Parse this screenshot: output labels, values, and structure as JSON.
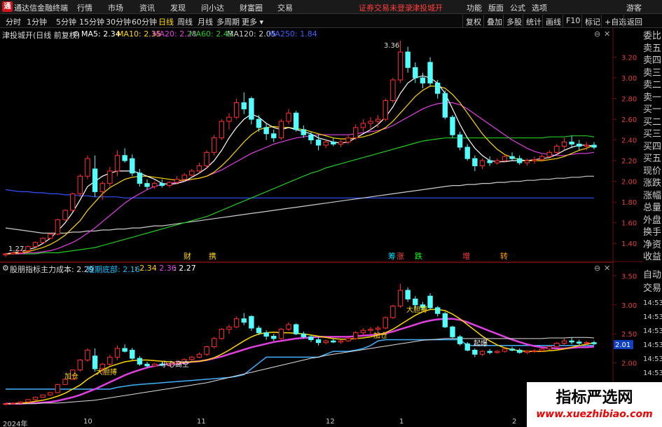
{
  "menubar": {
    "logo": "通",
    "app_name": "通达信金融终端",
    "items": [
      "行情",
      "市场",
      "资讯",
      "发现",
      "问小达",
      "财富圈",
      "交易"
    ],
    "notice": "证券交易未登录",
    "stock": "津投城开",
    "right_items": [
      "功能",
      "版面",
      "公式",
      "选项"
    ],
    "guest": "游客"
  },
  "toolbar": {
    "periods": [
      "分时",
      "1分钟",
      "5分钟",
      "15分钟",
      "30分钟",
      "60分钟",
      "日线",
      "周线",
      "月线",
      "多周期",
      "更多"
    ],
    "active_period": "日线",
    "buttons": [
      "复权",
      "叠加",
      "多股",
      "统计",
      "画线",
      "F10",
      "标记",
      "+自选",
      "返回"
    ]
  },
  "main_chart": {
    "title": "津投城开(日线 前复权)",
    "ma": [
      {
        "label": "MA5: 2.34",
        "color": "#ffffff"
      },
      {
        "label": "MA10: 2.35",
        "color": "#ffd700"
      },
      {
        "label": "MA20: 2.28",
        "color": "#e040e0"
      },
      {
        "label": "MA60: 2.43",
        "color": "#22cc22"
      },
      {
        "label": "MA120: 2.05",
        "color": "#cccccc"
      },
      {
        "label": "MA250: 1.84",
        "color": "#4060ff"
      }
    ],
    "y_ticks": [
      "3.20",
      "3.00",
      "2.80",
      "2.60",
      "2.40",
      "2.20",
      "2.00",
      "1.80",
      "1.60",
      "1.40"
    ],
    "high_label": "3.36",
    "low_label": "1.27",
    "event_marks": [
      {
        "text": "财",
        "color": "#ffd700"
      },
      {
        "text": "携",
        "color": "#ffd700"
      },
      {
        "text": "筹",
        "color": "#00e0ff"
      },
      {
        "text": "涨",
        "color": "#ff4040"
      },
      {
        "text": "跌",
        "color": "#00ff00"
      },
      {
        "text": "增",
        "color": "#ff4040"
      },
      {
        "text": "转",
        "color": "#ffa000"
      }
    ]
  },
  "sub_chart": {
    "title": "股朋指标",
    "main_cost_label": "主力成本: 2.29",
    "short_bottom_label": "短期底部: 2.16",
    "v2": ": 2.34",
    "v3": ": 2.36",
    "v4": ": 2.27",
    "y_ticks": [
      "3.50",
      "3.00",
      "2.50",
      "2.00"
    ],
    "current_value": "2.01",
    "signals": [
      "加仓",
      "大胆搏",
      "小心高空",
      "加仓",
      "大胆搏",
      "起爆"
    ]
  },
  "right_panel": {
    "items": [
      "委比",
      "卖五",
      "卖四",
      "卖三",
      "卖二",
      "卖一",
      "买一",
      "买二",
      "买三",
      "买四",
      "买五",
      "现价",
      "涨跌",
      "涨幅",
      "总量",
      "外盘",
      "换手",
      "净资",
      "收益"
    ],
    "lower": [
      "自动",
      "交易"
    ],
    "times": [
      "14:53",
      "14:53",
      "14:53",
      "14:53",
      "14:53",
      "14:53",
      "14:53"
    ]
  },
  "x_axis": {
    "labels": [
      "2024年",
      "10",
      "11",
      "12",
      "1",
      "2"
    ]
  },
  "watermark": {
    "title": "指标严选网",
    "url": "www.xuezhibiao.com"
  },
  "chart_data": {
    "type": "candlestick",
    "y_range": [
      1.3,
      3.4
    ],
    "ohlc": [
      [
        1.29,
        1.31,
        1.27,
        1.3
      ],
      [
        1.3,
        1.32,
        1.29,
        1.31
      ],
      [
        1.31,
        1.34,
        1.3,
        1.33
      ],
      [
        1.33,
        1.38,
        1.32,
        1.37
      ],
      [
        1.37,
        1.42,
        1.35,
        1.41
      ],
      [
        1.41,
        1.46,
        1.4,
        1.45
      ],
      [
        1.45,
        1.5,
        1.44,
        1.49
      ],
      [
        1.49,
        1.64,
        1.48,
        1.63
      ],
      [
        1.63,
        1.73,
        1.62,
        1.72
      ],
      [
        1.72,
        1.89,
        1.71,
        1.88
      ],
      [
        1.88,
        2.07,
        1.85,
        2.05
      ],
      [
        2.05,
        2.25,
        2.02,
        2.22
      ],
      [
        2.12,
        2.25,
        1.85,
        1.9
      ],
      [
        1.9,
        2.0,
        1.82,
        1.98
      ],
      [
        1.98,
        2.14,
        1.95,
        2.1
      ],
      [
        2.1,
        2.3,
        2.05,
        2.25
      ],
      [
        2.25,
        2.32,
        2.18,
        2.2
      ],
      [
        2.22,
        2.26,
        2.05,
        2.08
      ],
      [
        2.08,
        2.12,
        1.95,
        1.98
      ],
      [
        1.98,
        2.02,
        1.92,
        1.95
      ],
      [
        1.95,
        2.0,
        1.93,
        1.98
      ],
      [
        1.98,
        2.02,
        1.94,
        1.96
      ],
      [
        1.96,
        2.0,
        1.94,
        1.99
      ],
      [
        1.99,
        2.05,
        1.97,
        2.02
      ],
      [
        2.02,
        2.08,
        2.0,
        2.06
      ],
      [
        2.06,
        2.12,
        2.04,
        2.1
      ],
      [
        2.1,
        2.18,
        2.08,
        2.15
      ],
      [
        2.15,
        2.3,
        2.12,
        2.28
      ],
      [
        2.28,
        2.45,
        2.25,
        2.42
      ],
      [
        2.42,
        2.6,
        2.4,
        2.58
      ],
      [
        2.58,
        2.66,
        2.5,
        2.62
      ],
      [
        2.62,
        2.8,
        2.6,
        2.76
      ],
      [
        2.76,
        2.86,
        2.65,
        2.7
      ],
      [
        2.8,
        2.82,
        2.55,
        2.6
      ],
      [
        2.6,
        2.64,
        2.48,
        2.52
      ],
      [
        2.52,
        2.56,
        2.4,
        2.46
      ],
      [
        2.46,
        2.5,
        2.38,
        2.42
      ],
      [
        2.42,
        2.6,
        2.4,
        2.58
      ],
      [
        2.58,
        2.7,
        2.55,
        2.66
      ],
      [
        2.66,
        2.68,
        2.48,
        2.5
      ],
      [
        2.5,
        2.54,
        2.42,
        2.45
      ],
      [
        2.45,
        2.48,
        2.36,
        2.4
      ],
      [
        2.4,
        2.45,
        2.3,
        2.35
      ],
      [
        2.35,
        2.4,
        2.32,
        2.38
      ],
      [
        2.38,
        2.42,
        2.34,
        2.36
      ],
      [
        2.36,
        2.4,
        2.33,
        2.38
      ],
      [
        2.38,
        2.45,
        2.36,
        2.42
      ],
      [
        2.42,
        2.55,
        2.4,
        2.52
      ],
      [
        2.52,
        2.6,
        2.48,
        2.56
      ],
      [
        2.56,
        2.62,
        2.5,
        2.58
      ],
      [
        2.58,
        2.64,
        2.52,
        2.6
      ],
      [
        2.6,
        2.8,
        2.58,
        2.78
      ],
      [
        2.78,
        3.0,
        2.76,
        2.98
      ],
      [
        2.98,
        3.36,
        2.95,
        3.25
      ],
      [
        3.25,
        3.3,
        3.05,
        3.1
      ],
      [
        3.1,
        3.15,
        2.95,
        3.0
      ],
      [
        3.0,
        3.05,
        2.9,
        2.95
      ],
      [
        3.15,
        3.2,
        2.92,
        2.95
      ],
      [
        2.95,
        2.98,
        2.8,
        2.85
      ],
      [
        2.85,
        2.88,
        2.6,
        2.62
      ],
      [
        2.62,
        2.64,
        2.42,
        2.45
      ],
      [
        2.45,
        2.48,
        2.3,
        2.33
      ],
      [
        2.33,
        2.36,
        2.2,
        2.22
      ],
      [
        2.22,
        2.25,
        2.1,
        2.15
      ],
      [
        2.15,
        2.22,
        2.12,
        2.2
      ],
      [
        2.2,
        2.24,
        2.15,
        2.18
      ],
      [
        2.18,
        2.22,
        2.16,
        2.2
      ],
      [
        2.2,
        2.26,
        2.18,
        2.24
      ],
      [
        2.24,
        2.28,
        2.2,
        2.22
      ],
      [
        2.22,
        2.25,
        2.16,
        2.18
      ],
      [
        2.18,
        2.22,
        2.15,
        2.2
      ],
      [
        2.2,
        2.24,
        2.17,
        2.21
      ],
      [
        2.21,
        2.26,
        2.19,
        2.24
      ],
      [
        2.24,
        2.3,
        2.22,
        2.28
      ],
      [
        2.28,
        2.36,
        2.26,
        2.34
      ],
      [
        2.34,
        2.42,
        2.3,
        2.38
      ],
      [
        2.38,
        2.44,
        2.32,
        2.36
      ],
      [
        2.36,
        2.4,
        2.3,
        2.34
      ],
      [
        2.34,
        2.38,
        2.3,
        2.35
      ],
      [
        2.35,
        2.38,
        2.31,
        2.33
      ]
    ],
    "ma5": [
      1.3,
      1.31,
      1.32,
      1.34,
      1.36,
      1.4,
      1.45,
      1.52,
      1.6,
      1.7,
      1.82,
      1.95,
      2.0,
      2.05,
      2.08,
      2.1,
      2.1,
      2.1,
      2.08,
      2.05,
      2.02,
      1.98,
      1.97,
      1.98,
      2.0,
      2.04,
      2.08,
      2.13,
      2.2,
      2.3,
      2.42,
      2.52,
      2.6,
      2.65,
      2.62,
      2.56,
      2.52,
      2.5,
      2.52,
      2.5,
      2.48,
      2.46,
      2.42,
      2.4,
      2.38,
      2.37,
      2.38,
      2.42,
      2.46,
      2.5,
      2.55,
      2.62,
      2.72,
      2.85,
      2.95,
      3.0,
      3.02,
      3.0,
      2.95,
      2.85,
      2.7,
      2.55,
      2.42,
      2.32,
      2.25,
      2.2,
      2.19,
      2.19,
      2.2,
      2.2,
      2.2,
      2.21,
      2.22,
      2.23,
      2.26,
      2.3,
      2.33,
      2.35,
      2.35,
      2.34
    ],
    "ma10": [
      1.3,
      1.3,
      1.31,
      1.32,
      1.34,
      1.36,
      1.39,
      1.43,
      1.48,
      1.55,
      1.62,
      1.72,
      1.8,
      1.88,
      1.94,
      1.98,
      2.02,
      2.04,
      2.05,
      2.05,
      2.04,
      2.03,
      2.02,
      2.01,
      2.01,
      2.02,
      2.03,
      2.05,
      2.09,
      2.15,
      2.22,
      2.3,
      2.38,
      2.45,
      2.5,
      2.52,
      2.53,
      2.52,
      2.52,
      2.51,
      2.5,
      2.48,
      2.46,
      2.44,
      2.42,
      2.41,
      2.41,
      2.42,
      2.43,
      2.45,
      2.48,
      2.52,
      2.58,
      2.66,
      2.74,
      2.82,
      2.88,
      2.92,
      2.92,
      2.9,
      2.84,
      2.76,
      2.66,
      2.56,
      2.46,
      2.38,
      2.31,
      2.26,
      2.23,
      2.21,
      2.2,
      2.2,
      2.2,
      2.21,
      2.22,
      2.24,
      2.27,
      2.3,
      2.32,
      2.35
    ],
    "ma20": [
      1.3,
      1.3,
      1.3,
      1.31,
      1.31,
      1.32,
      1.33,
      1.35,
      1.38,
      1.41,
      1.45,
      1.5,
      1.55,
      1.61,
      1.67,
      1.73,
      1.79,
      1.84,
      1.88,
      1.92,
      1.95,
      1.97,
      1.98,
      1.99,
      2.0,
      2.02,
      2.03,
      2.05,
      2.08,
      2.11,
      2.15,
      2.19,
      2.23,
      2.27,
      2.3,
      2.33,
      2.36,
      2.38,
      2.4,
      2.42,
      2.43,
      2.44,
      2.45,
      2.45,
      2.45,
      2.45,
      2.45,
      2.46,
      2.47,
      2.48,
      2.49,
      2.51,
      2.54,
      2.58,
      2.62,
      2.66,
      2.7,
      2.73,
      2.75,
      2.76,
      2.76,
      2.74,
      2.7,
      2.65,
      2.6,
      2.55,
      2.5,
      2.45,
      2.4,
      2.36,
      2.32,
      2.29,
      2.27,
      2.26,
      2.25,
      2.25,
      2.26,
      2.27,
      2.27,
      2.28
    ],
    "ma60": [
      1.3,
      1.3,
      1.3,
      1.3,
      1.3,
      1.31,
      1.31,
      1.31,
      1.32,
      1.33,
      1.34,
      1.35,
      1.36,
      1.38,
      1.4,
      1.42,
      1.44,
      1.46,
      1.48,
      1.5,
      1.52,
      1.54,
      1.56,
      1.58,
      1.6,
      1.62,
      1.64,
      1.66,
      1.69,
      1.72,
      1.75,
      1.78,
      1.81,
      1.84,
      1.87,
      1.9,
      1.93,
      1.96,
      1.99,
      2.02,
      2.05,
      2.08,
      2.1,
      2.13,
      2.15,
      2.17,
      2.19,
      2.21,
      2.23,
      2.25,
      2.27,
      2.29,
      2.31,
      2.33,
      2.35,
      2.37,
      2.39,
      2.4,
      2.41,
      2.42,
      2.42,
      2.42,
      2.42,
      2.42,
      2.42,
      2.42,
      2.42,
      2.42,
      2.42,
      2.42,
      2.42,
      2.42,
      2.42,
      2.43,
      2.43,
      2.43,
      2.44,
      2.44,
      2.44,
      2.43
    ],
    "ma120": [
      1.55,
      1.54,
      1.53,
      1.52,
      1.51,
      1.5,
      1.5,
      1.5,
      1.5,
      1.51,
      1.51,
      1.52,
      1.52,
      1.53,
      1.53,
      1.54,
      1.54,
      1.55,
      1.55,
      1.56,
      1.57,
      1.57,
      1.58,
      1.59,
      1.6,
      1.61,
      1.62,
      1.63,
      1.64,
      1.65,
      1.66,
      1.67,
      1.68,
      1.69,
      1.7,
      1.71,
      1.72,
      1.73,
      1.74,
      1.75,
      1.76,
      1.77,
      1.78,
      1.79,
      1.8,
      1.81,
      1.82,
      1.83,
      1.84,
      1.85,
      1.86,
      1.87,
      1.88,
      1.89,
      1.9,
      1.91,
      1.92,
      1.93,
      1.94,
      1.95,
      1.96,
      1.96,
      1.97,
      1.97,
      1.98,
      1.98,
      1.99,
      1.99,
      2.0,
      2.0,
      2.01,
      2.01,
      2.02,
      2.02,
      2.03,
      2.03,
      2.04,
      2.04,
      2.05,
      2.05
    ],
    "ma250": [
      1.92,
      1.91,
      1.9,
      1.9,
      1.89,
      1.89,
      1.88,
      1.88,
      1.87,
      1.87,
      1.86,
      1.86,
      1.85,
      1.85,
      1.85,
      1.85,
      1.84,
      1.84,
      1.84,
      1.84,
      1.84,
      1.84,
      1.84,
      1.84,
      1.84,
      1.84,
      1.84,
      1.84,
      1.84,
      1.84,
      1.84,
      1.84,
      1.84,
      1.84,
      1.84,
      1.84,
      1.84,
      1.84,
      1.84,
      1.84,
      1.84,
      1.84,
      1.84,
      1.84,
      1.84,
      1.84,
      1.84,
      1.84,
      1.84,
      1.84,
      1.84,
      1.84,
      1.84,
      1.84,
      1.84,
      1.84,
      1.84,
      1.84,
      1.84,
      1.84,
      1.84,
      1.84,
      1.84,
      1.84,
      1.84,
      1.84,
      1.84,
      1.84,
      1.84,
      1.84,
      1.84,
      1.84,
      1.84,
      1.84,
      1.84,
      1.84,
      1.84,
      1.84,
      1.84,
      1.84
    ],
    "sub_y_range": [
      1.55,
      3.6
    ],
    "short_bottom": [
      1.55,
      1.55,
      1.55,
      1.55,
      1.55,
      1.55,
      1.55,
      1.55,
      1.55,
      1.55,
      1.55,
      1.55,
      1.55,
      1.55,
      1.55,
      1.58,
      1.6,
      1.62,
      1.63,
      1.64,
      1.65,
      1.66,
      1.67,
      1.68,
      1.69,
      1.7,
      1.71,
      1.72,
      1.73,
      1.74,
      1.75,
      1.77,
      1.8,
      1.9,
      2.0,
      2.1,
      2.1,
      2.1,
      2.1,
      2.1,
      2.1,
      2.1,
      2.1,
      2.15,
      2.2,
      2.2,
      2.2,
      2.22,
      2.25,
      2.3,
      2.38,
      2.4,
      2.4,
      2.4,
      2.4,
      2.4,
      2.4,
      2.4,
      2.4,
      2.4,
      2.4,
      2.4,
      2.3,
      2.3,
      2.3,
      2.3,
      2.3,
      2.3,
      2.3,
      2.3,
      2.3,
      2.3,
      2.3,
      2.3,
      2.3,
      2.3,
      2.3,
      2.3,
      2.3,
      2.3
    ]
  }
}
